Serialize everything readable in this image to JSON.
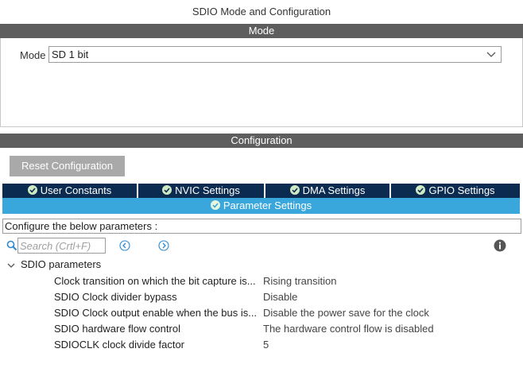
{
  "title": "SDIO Mode and Configuration",
  "mode_section": {
    "header": "Mode",
    "label": "Mode",
    "selected_value": "SD 1 bit"
  },
  "config_section": {
    "header": "Configuration",
    "reset_button": "Reset Configuration",
    "tabs": [
      {
        "label": "User Constants",
        "icon": "check-circle-icon"
      },
      {
        "label": "NVIC Settings",
        "icon": "check-circle-icon"
      },
      {
        "label": "DMA Settings",
        "icon": "check-circle-icon"
      },
      {
        "label": "GPIO Settings",
        "icon": "check-circle-icon"
      }
    ],
    "active_tab": {
      "label": "Parameter Settings",
      "icon": "check-circle-icon"
    },
    "configure_text": "Configure the below parameters :",
    "search_placeholder": "Search (Crtl+F)",
    "group_title": "SDIO parameters",
    "parameters": [
      {
        "name": "Clock transition on which the bit capture is...",
        "value": "Rising transition"
      },
      {
        "name": "SDIO Clock divider bypass",
        "value": "Disable"
      },
      {
        "name": "SDIO Clock output enable when the bus is...",
        "value": "Disable the power save for the clock"
      },
      {
        "name": "SDIO hardware flow control",
        "value": "The hardware control flow is disabled"
      },
      {
        "name": "SDIOCLK clock divide factor",
        "value": "5"
      }
    ]
  },
  "colors": {
    "section_bar": "#5e5e5e",
    "tab_dark": "#0b2b50",
    "tab_active": "#39a7dc",
    "button_gray": "#a9a9a9",
    "icon_blue": "#2a8ad4"
  }
}
